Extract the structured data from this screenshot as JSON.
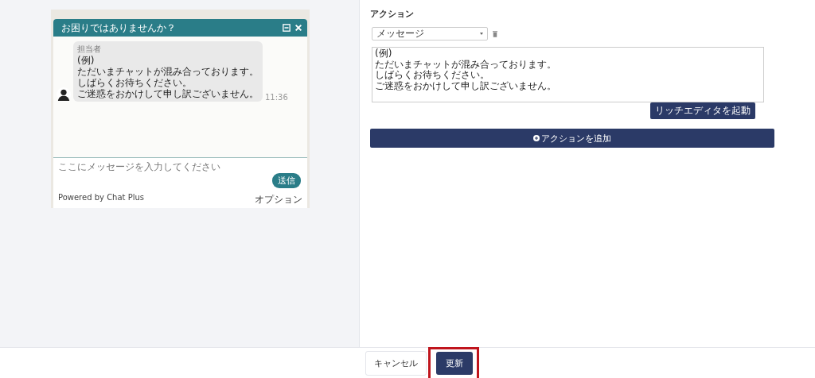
{
  "preview": {
    "header_title": "お困りではありませんか？",
    "message": {
      "sender": "担当者",
      "lines": [
        "(例)",
        "ただいまチャットが混み合っております。",
        "しばらくお待ちください。",
        "ご迷惑をおかけして申し訳ございません。"
      ],
      "time": "11:36"
    },
    "input": {
      "placeholder": "ここにメッセージを入力してください"
    },
    "send_button": "送信",
    "powered_by": "Powered by Chat Plus",
    "option_link": "オプション"
  },
  "action": {
    "title": "アクション",
    "type_select": "メッセージ",
    "message_lines": [
      "(例)",
      "ただいまチャットが混み合っております。",
      "しばらくお待ちください。",
      "ご迷惑をおかけして申し訳ございません。"
    ],
    "rich_editor_button": "リッチエディタを起動",
    "add_button": "アクションを追加"
  },
  "footer": {
    "buttons": [
      {
        "label": "キャンセル",
        "kind": "secondary",
        "highlighted": false
      },
      {
        "label": "更新",
        "kind": "primary",
        "highlighted": true
      }
    ]
  }
}
